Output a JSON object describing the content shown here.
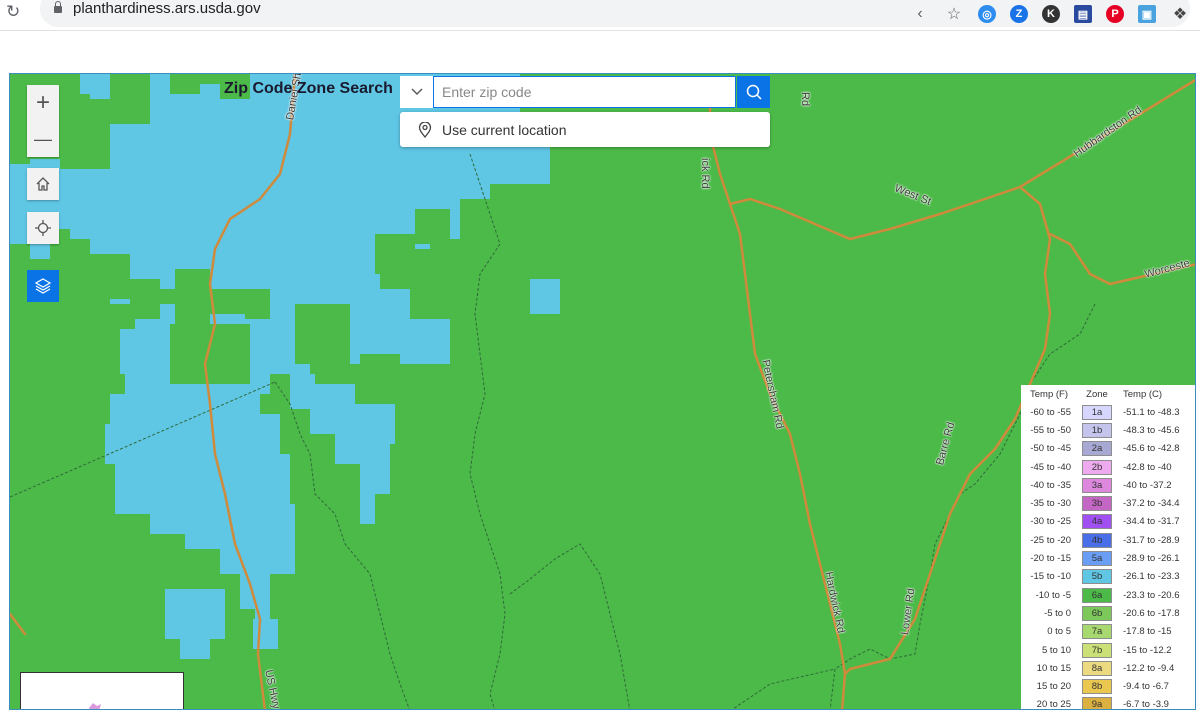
{
  "browser": {
    "url": "planthardiness.ars.usda.gov",
    "extensions": [
      {
        "name": "compass-extension",
        "color": "#2d8cf0",
        "glyph": "◎"
      },
      {
        "name": "zoom-extension",
        "color": "#1a73e8",
        "glyph": "Z"
      },
      {
        "name": "k-extension",
        "color": "#333333",
        "glyph": "K"
      },
      {
        "name": "reader-extension",
        "color": "#2a4aa0",
        "glyph": "▤"
      },
      {
        "name": "pinterest-extension",
        "color": "#e60023",
        "glyph": "P"
      },
      {
        "name": "screenshot-extension",
        "color": "#4aa3df",
        "glyph": "▣"
      }
    ]
  },
  "search": {
    "title": "Zip Code Zone Search",
    "placeholder": "Enter zip code",
    "value": "",
    "suggestion": "Use current location"
  },
  "map_controls": {
    "zoom_in": "+",
    "zoom_out": "—"
  },
  "road_labels": [
    {
      "text": "Daniel Shay",
      "name": "road-label-daniel-shays"
    },
    {
      "text": "Rd",
      "name": "road-label-rd-top"
    },
    {
      "text": "ick Rd",
      "name": "road-label-hardwick-top"
    },
    {
      "text": "Hubbardston Rd",
      "name": "road-label-hubbardston"
    },
    {
      "text": "West St",
      "name": "road-label-west-st"
    },
    {
      "text": "Worceste",
      "name": "road-label-worcester"
    },
    {
      "text": "Petersham Rd",
      "name": "road-label-petersham"
    },
    {
      "text": "Barre Rd",
      "name": "road-label-barre"
    },
    {
      "text": "Hardwick Rd",
      "name": "road-label-hardwick"
    },
    {
      "text": "Lower Rd",
      "name": "road-label-lower"
    },
    {
      "text": "US Hwy",
      "name": "road-label-us-hwy"
    }
  ],
  "legend": {
    "headers": [
      "Temp (F)",
      "Zone",
      "Temp (C)"
    ],
    "rows": [
      {
        "f": "-60 to -55",
        "zone": "1a",
        "c": "-51.1 to -48.3",
        "color": "#d6d6ff"
      },
      {
        "f": "-55 to -50",
        "zone": "1b",
        "c": "-48.3 to -45.6",
        "color": "#c4c4ec"
      },
      {
        "f": "-50 to -45",
        "zone": "2a",
        "c": "-45.6 to -42.8",
        "color": "#a8a8d4"
      },
      {
        "f": "-45 to -40",
        "zone": "2b",
        "c": "-42.8 to -40",
        "color": "#eeaaee"
      },
      {
        "f": "-40 to -35",
        "zone": "3a",
        "c": "-40 to -37.2",
        "color": "#dd88dd"
      },
      {
        "f": "-35 to -30",
        "zone": "3b",
        "c": "-37.2 to -34.4",
        "color": "#c466c4"
      },
      {
        "f": "-30 to -25",
        "zone": "4a",
        "c": "-34.4 to -31.7",
        "color": "#a050f0"
      },
      {
        "f": "-25 to -20",
        "zone": "4b",
        "c": "-31.7 to -28.9",
        "color": "#4a6ee8"
      },
      {
        "f": "-20 to -15",
        "zone": "5a",
        "c": "-28.9 to -26.1",
        "color": "#6a9ef5"
      },
      {
        "f": "-15 to -10",
        "zone": "5b",
        "c": "-26.1 to -23.3",
        "color": "#5fc6e4"
      },
      {
        "f": "-10 to -5",
        "zone": "6a",
        "c": "-23.3 to -20.6",
        "color": "#4cba48"
      },
      {
        "f": "-5 to 0",
        "zone": "6b",
        "c": "-20.6 to -17.8",
        "color": "#7dc85a"
      },
      {
        "f": "0 to 5",
        "zone": "7a",
        "c": "-17.8 to -15",
        "color": "#a8d870"
      },
      {
        "f": "5 to 10",
        "zone": "7b",
        "c": "-15 to -12.2",
        "color": "#cce078"
      },
      {
        "f": "10 to 15",
        "zone": "8a",
        "c": "-12.2 to -9.4",
        "color": "#ecda80"
      },
      {
        "f": "15 to 20",
        "zone": "8b",
        "c": "-9.4 to -6.7",
        "color": "#eac850"
      },
      {
        "f": "20 to 25",
        "zone": "9a",
        "c": "-6.7 to -3.9",
        "color": "#dcb040"
      }
    ]
  },
  "colors": {
    "zone_6a": "#4cba48",
    "zone_5b": "#5fc6e4",
    "road": "#d08a3c",
    "accent": "#0a74e6"
  }
}
